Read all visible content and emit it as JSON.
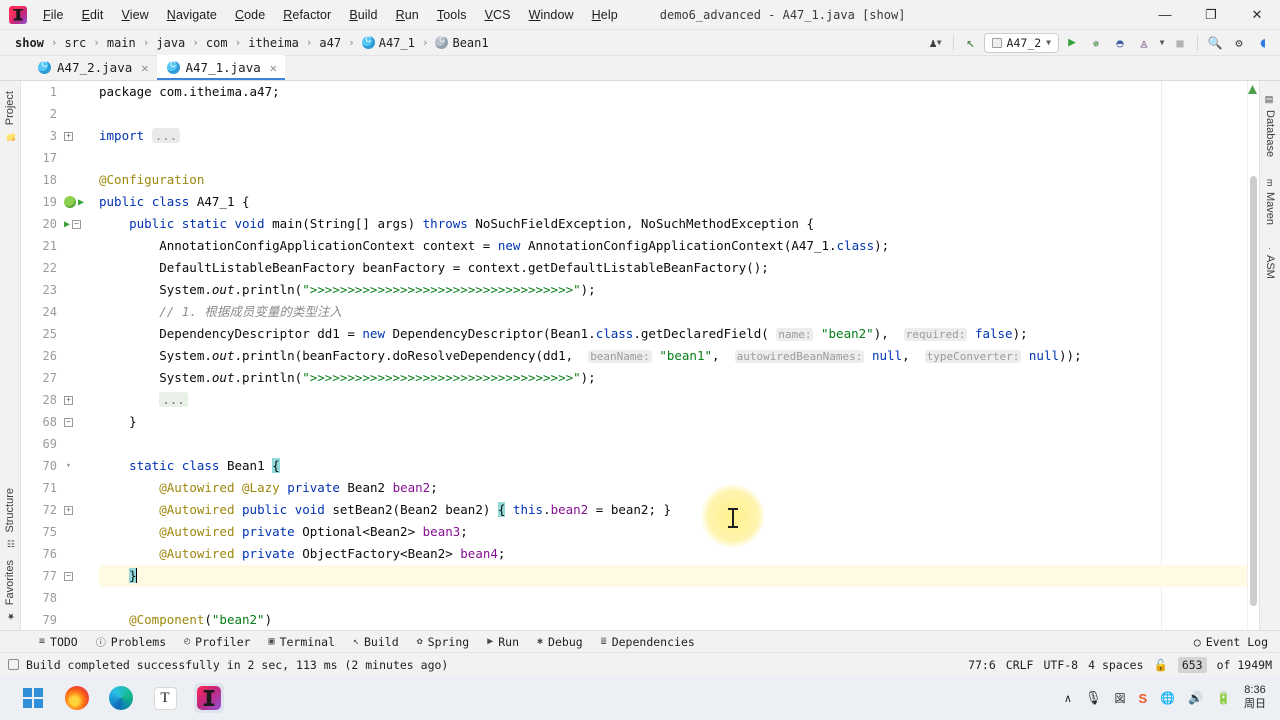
{
  "titlebar": {
    "app_icon": "intellij-idea-logo",
    "menu": [
      "File",
      "Edit",
      "View",
      "Navigate",
      "Code",
      "Refactor",
      "Build",
      "Run",
      "Tools",
      "VCS",
      "Window",
      "Help"
    ],
    "window_title": "demo6_advanced - A47_1.java [show]",
    "minimize": "—",
    "maximize": "❐",
    "close": "✕"
  },
  "navbar": {
    "breadcrumbs": [
      {
        "label": "show",
        "icon": null,
        "bold": true
      },
      {
        "label": "src",
        "icon": null,
        "bold": false
      },
      {
        "label": "main",
        "icon": null,
        "bold": false
      },
      {
        "label": "java",
        "icon": null,
        "bold": false
      },
      {
        "label": "com",
        "icon": null,
        "bold": false
      },
      {
        "label": "itheima",
        "icon": null,
        "bold": false
      },
      {
        "label": "a47",
        "icon": null,
        "bold": false
      },
      {
        "label": "A47_1",
        "icon": "class-icon",
        "bold": false
      },
      {
        "label": "Bean1",
        "icon": "class-icon-grey",
        "bold": false
      }
    ],
    "separator": "›",
    "run_config": "A47_2",
    "buttons": [
      {
        "name": "user-avatar-icon",
        "glyph": "♟"
      },
      {
        "name": "updates-icon",
        "glyph": "↖"
      },
      {
        "name": "run-button",
        "glyph": "▶"
      },
      {
        "name": "debug-button",
        "glyph": "🐞"
      },
      {
        "name": "run-with-coverage-button",
        "glyph": "◑"
      },
      {
        "name": "profiler-button",
        "glyph": "◴"
      },
      {
        "name": "stop-button",
        "glyph": "■"
      },
      {
        "name": "search-everywhere-icon",
        "glyph": "🔍"
      },
      {
        "name": "settings-gear-icon",
        "glyph": "⚙"
      },
      {
        "name": "ide-assistant-icon",
        "glyph": "◖"
      }
    ]
  },
  "tabs": [
    {
      "label": "A47_2.java",
      "active": false,
      "close": "✕",
      "icon": "java-class-icon"
    },
    {
      "label": "A47_1.java",
      "active": true,
      "close": "✕",
      "icon": "java-class-icon"
    }
  ],
  "left_strip": {
    "top": {
      "label": "Project",
      "icon": "project-folder-icon"
    },
    "bottom": [
      {
        "label": "Structure",
        "icon": "structure-icon"
      },
      {
        "label": "Favorites",
        "icon": "star-icon"
      }
    ]
  },
  "right_strip": [
    {
      "label": "Database",
      "icon": "database-icon"
    },
    {
      "label": "Maven",
      "icon": "maven-m-icon"
    },
    {
      "label": "ASM",
      "icon": "asm-icon"
    }
  ],
  "editor": {
    "lines": [
      {
        "num": "1",
        "mark": "",
        "html": "package com.itheima.a47;"
      },
      {
        "num": "2",
        "mark": "",
        "html": ""
      },
      {
        "num": "3",
        "mark": "foldplus",
        "html": "<span class=\"kw\">import</span> <span class=\"impl\">...</span>"
      },
      {
        "num": "17",
        "mark": "",
        "html": ""
      },
      {
        "num": "18",
        "mark": "",
        "html": "<span class=\"ann\">@Configuration</span>"
      },
      {
        "num": "19",
        "mark": "spring-run",
        "html": "<span class=\"kw\">public</span> <span class=\"kw\">class</span> A47_1 {"
      },
      {
        "num": "20",
        "mark": "run-fold",
        "html": "    <span class=\"kw\">public</span> <span class=\"kw\">static</span> <span class=\"kw\">void</span> main(String[] args) <span class=\"kw\">throws</span> NoSuchFieldException, NoSuchMethodException {"
      },
      {
        "num": "21",
        "mark": "",
        "html": "        AnnotationConfigApplicationContext context = <span class=\"kw\">new</span> AnnotationConfigApplicationContext(A47_1.<span class=\"kw\">class</span>);"
      },
      {
        "num": "22",
        "mark": "",
        "html": "        DefaultListableBeanFactory beanFactory = context.getDefaultListableBeanFactory();"
      },
      {
        "num": "23",
        "mark": "",
        "html": "        System.<span class=\"stat\">out</span>.println(<span class=\"str\">\"&gt;&gt;&gt;&gt;&gt;&gt;&gt;&gt;&gt;&gt;&gt;&gt;&gt;&gt;&gt;&gt;&gt;&gt;&gt;&gt;&gt;&gt;&gt;&gt;&gt;&gt;&gt;&gt;&gt;&gt;&gt;&gt;&gt;&gt;&gt;\"</span>);"
      },
      {
        "num": "24",
        "mark": "",
        "html": "        <span class=\"cmt\">// 1. 根据成员变量的类型注入</span>"
      },
      {
        "num": "25",
        "mark": "",
        "html": "        DependencyDescriptor dd1 = <span class=\"kw\">new</span> DependencyDescriptor(Bean1.<span class=\"kw\">class</span>.getDeclaredField( <span class=\"hint\">name:</span> <span class=\"str\">\"bean2\"</span>),  <span class=\"hint\">required:</span> <span class=\"kw\">false</span>);"
      },
      {
        "num": "26",
        "mark": "",
        "html": "        System.<span class=\"stat\">out</span>.println(beanFactory.doResolveDependency(dd1,  <span class=\"hint\">beanName:</span> <span class=\"str\">\"bean1\"</span>,  <span class=\"hint\">autowiredBeanNames:</span> <span class=\"kw\">null</span>,  <span class=\"hint\">typeConverter:</span> <span class=\"kw\">null</span>));"
      },
      {
        "num": "27",
        "mark": "",
        "html": "        System.<span class=\"stat\">out</span>.println(<span class=\"str\">\"&gt;&gt;&gt;&gt;&gt;&gt;&gt;&gt;&gt;&gt;&gt;&gt;&gt;&gt;&gt;&gt;&gt;&gt;&gt;&gt;&gt;&gt;&gt;&gt;&gt;&gt;&gt;&gt;&gt;&gt;&gt;&gt;&gt;&gt;&gt;\"</span>);"
      },
      {
        "num": "28",
        "mark": "foldplus",
        "html": "        <span class=\"ellipsis\">...</span>"
      },
      {
        "num": "68",
        "mark": "foldminus",
        "html": "    }"
      },
      {
        "num": "69",
        "mark": "",
        "html": ""
      },
      {
        "num": "70",
        "mark": "foldarrow",
        "html": "    <span class=\"kw\">static</span> <span class=\"kw\">class</span> Bean1 <span class=\"brmatch\">{</span>"
      },
      {
        "num": "71",
        "mark": "",
        "html": "        <span class=\"ann\">@Autowired</span> <span class=\"ann\">@Lazy</span> <span class=\"kw\">private</span> Bean2 <span class=\"fld\">bean2</span>;"
      },
      {
        "num": "72",
        "mark": "foldplus",
        "html": "        <span class=\"ann\">@Autowired</span> <span class=\"kw\">public</span> <span class=\"kw\">void</span> setBean2(Bean2 bean2) <span class=\"brmatch\">{</span> <span class=\"kw\">this</span>.<span class=\"fld\">bean2</span> = bean2; }"
      },
      {
        "num": "75",
        "mark": "",
        "html": "        <span class=\"ann\">@Autowired</span> <span class=\"kw\">private</span> Optional&lt;Bean2&gt; <span class=\"fld\">bean3</span>;"
      },
      {
        "num": "76",
        "mark": "",
        "html": "        <span class=\"ann\">@Autowired</span> <span class=\"kw\">private</span> ObjectFactory&lt;Bean2&gt; <span class=\"fld\">bean4</span>;"
      },
      {
        "num": "77",
        "mark": "foldminus",
        "html": "    <span class=\"brmatch\">}</span><span class=\"caret-bar\"></span>",
        "highlight": true
      },
      {
        "num": "78",
        "mark": "",
        "html": ""
      },
      {
        "num": "79",
        "mark": "",
        "html": "    <span class=\"ann\">@Component</span>(<span class=\"str\">\"bean2\"</span>)"
      }
    ]
  },
  "bottom_toolwindows": [
    {
      "label": "TODO",
      "icon": "todo-list-icon",
      "glyph": "≡"
    },
    {
      "label": "Problems",
      "icon": "problems-icon",
      "glyph": "ⓘ"
    },
    {
      "label": "Profiler",
      "icon": "profiler-icon",
      "glyph": "◴"
    },
    {
      "label": "Terminal",
      "icon": "terminal-icon",
      "glyph": "▣"
    },
    {
      "label": "Build",
      "icon": "build-hammer-icon",
      "glyph": "↖"
    },
    {
      "label": "Spring",
      "icon": "spring-leaf-icon",
      "glyph": "✿"
    },
    {
      "label": "Run",
      "icon": "run-play-icon",
      "glyph": "▶"
    },
    {
      "label": "Debug",
      "icon": "debug-bug-icon",
      "glyph": "✱"
    },
    {
      "label": "Dependencies",
      "icon": "dependencies-icon",
      "glyph": "≣"
    }
  ],
  "event_log": {
    "label": "Event Log",
    "icon": "event-log-icon",
    "glyph": "○"
  },
  "statusbar": {
    "build_icon": "build-status-icon",
    "message": "Build completed successfully in 2 sec, 113 ms (2 minutes ago)",
    "caret_position": "77:6",
    "line_separator": "CRLF",
    "encoding": "UTF-8",
    "indent": "4 spaces",
    "lock_icon": "unlocked-padlock-icon",
    "memory_used": "653",
    "memory_total": "of 1949M"
  },
  "taskbar": {
    "items": [
      {
        "name": "windows-start-icon",
        "label": "Start"
      },
      {
        "name": "firefox-icon",
        "label": "Firefox"
      },
      {
        "name": "edge-icon",
        "label": "Microsoft Edge"
      },
      {
        "name": "typora-icon",
        "label": "T"
      },
      {
        "name": "intellij-idea-taskbar-icon",
        "label": "IntelliJ IDEA",
        "active": true
      }
    ],
    "tray": [
      {
        "name": "chevron-up-icon",
        "glyph": "∧"
      },
      {
        "name": "microphone-icon",
        "glyph": "🎙"
      },
      {
        "name": "input-method-icon",
        "glyph": "図"
      },
      {
        "name": "sogou-input-icon",
        "glyph": "S"
      },
      {
        "name": "network-icon",
        "glyph": "🌐"
      },
      {
        "name": "volume-icon",
        "glyph": "🔊"
      },
      {
        "name": "battery-icon",
        "glyph": "🔋"
      }
    ],
    "clock_time": "8:36",
    "clock_date": "周日"
  }
}
